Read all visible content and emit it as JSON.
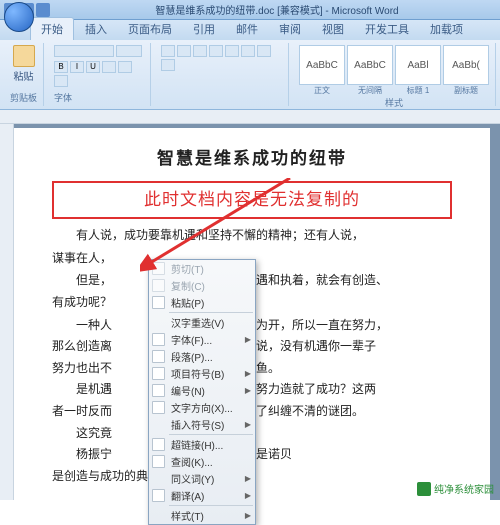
{
  "title": "智慧是维系成功的纽带.doc [兼容模式] - Microsoft Word",
  "tabs": [
    "开始",
    "插入",
    "页面布局",
    "引用",
    "邮件",
    "审阅",
    "视图",
    "开发工具",
    "加载项"
  ],
  "active_tab": 0,
  "clipboard": {
    "paste": "粘贴",
    "label": "剪贴板"
  },
  "font_group_label": "字体",
  "style_group_label": "样式",
  "styles": [
    {
      "preview": "AaBbC",
      "name": "正文"
    },
    {
      "preview": "AaBbC",
      "name": "无间隔"
    },
    {
      "preview": "AaBl",
      "name": "标题 1"
    },
    {
      "preview": "AaBb(",
      "name": "副标题"
    }
  ],
  "doc": {
    "title": "智慧是维系成功的纽带",
    "callout": "此时文档内容是无法复制的",
    "p1": "有人说，成功要靠机遇和坚持不懈的精神；还有人说，",
    "p2_a": "谋事在人，",
    "p2_b": "",
    "p3_a": "但是，",
    "p3_b": "有了一定的机遇和执着，就会有创造、",
    "p4": "有成功呢？",
    "p5_a": "一种人",
    "p5_b": "诚所至，金石为开，所以一直在努力，",
    "p6_a": "那么创造离",
    "p6_b": "遥远；反对者说，没有机遇你一辈子",
    "p7_a": "努力也出不",
    "p7_b": "好比姜太公钓鱼。",
    "p8_a": "是机遇",
    "p8_b": "力，是不懈的努力造就了成功？这两",
    "p9_a": "者一时反而",
    "p9_b": "的统一体，成了纠缠不清的谜团。",
    "p10_a": "这究竟",
    "p10_b": "",
    "p11_a": "杨振宁",
    "p11_b": "大家都很熟，是诺贝",
    "p12": "是创造与成功的典范。恰恰在不久"
  },
  "context_menu": [
    {
      "label": "剪切(T)",
      "disabled": true,
      "icon": true
    },
    {
      "label": "复制(C)",
      "disabled": true,
      "icon": true
    },
    {
      "label": "粘贴(P)",
      "icon": true
    },
    {
      "sep": true
    },
    {
      "label": "汉字重选(V)"
    },
    {
      "label": "字体(F)...",
      "icon": true,
      "sub": true
    },
    {
      "label": "段落(P)...",
      "icon": true
    },
    {
      "label": "项目符号(B)",
      "icon": true,
      "sub": true
    },
    {
      "label": "编号(N)",
      "icon": true,
      "sub": true
    },
    {
      "label": "文字方向(X)...",
      "icon": true
    },
    {
      "label": "插入符号(S)",
      "sub": true
    },
    {
      "sep": true
    },
    {
      "label": "超链接(H)...",
      "icon": true
    },
    {
      "label": "查阅(K)...",
      "icon": true
    },
    {
      "label": "同义词(Y)",
      "sub": true
    },
    {
      "label": "翻译(A)",
      "icon": true,
      "sub": true
    },
    {
      "sep": true
    },
    {
      "label": "样式(T)",
      "sub": true
    }
  ],
  "watermark": "纯净系统家园",
  "colors": {
    "accent": "#e03030",
    "ribbon": "#c3daf0"
  }
}
